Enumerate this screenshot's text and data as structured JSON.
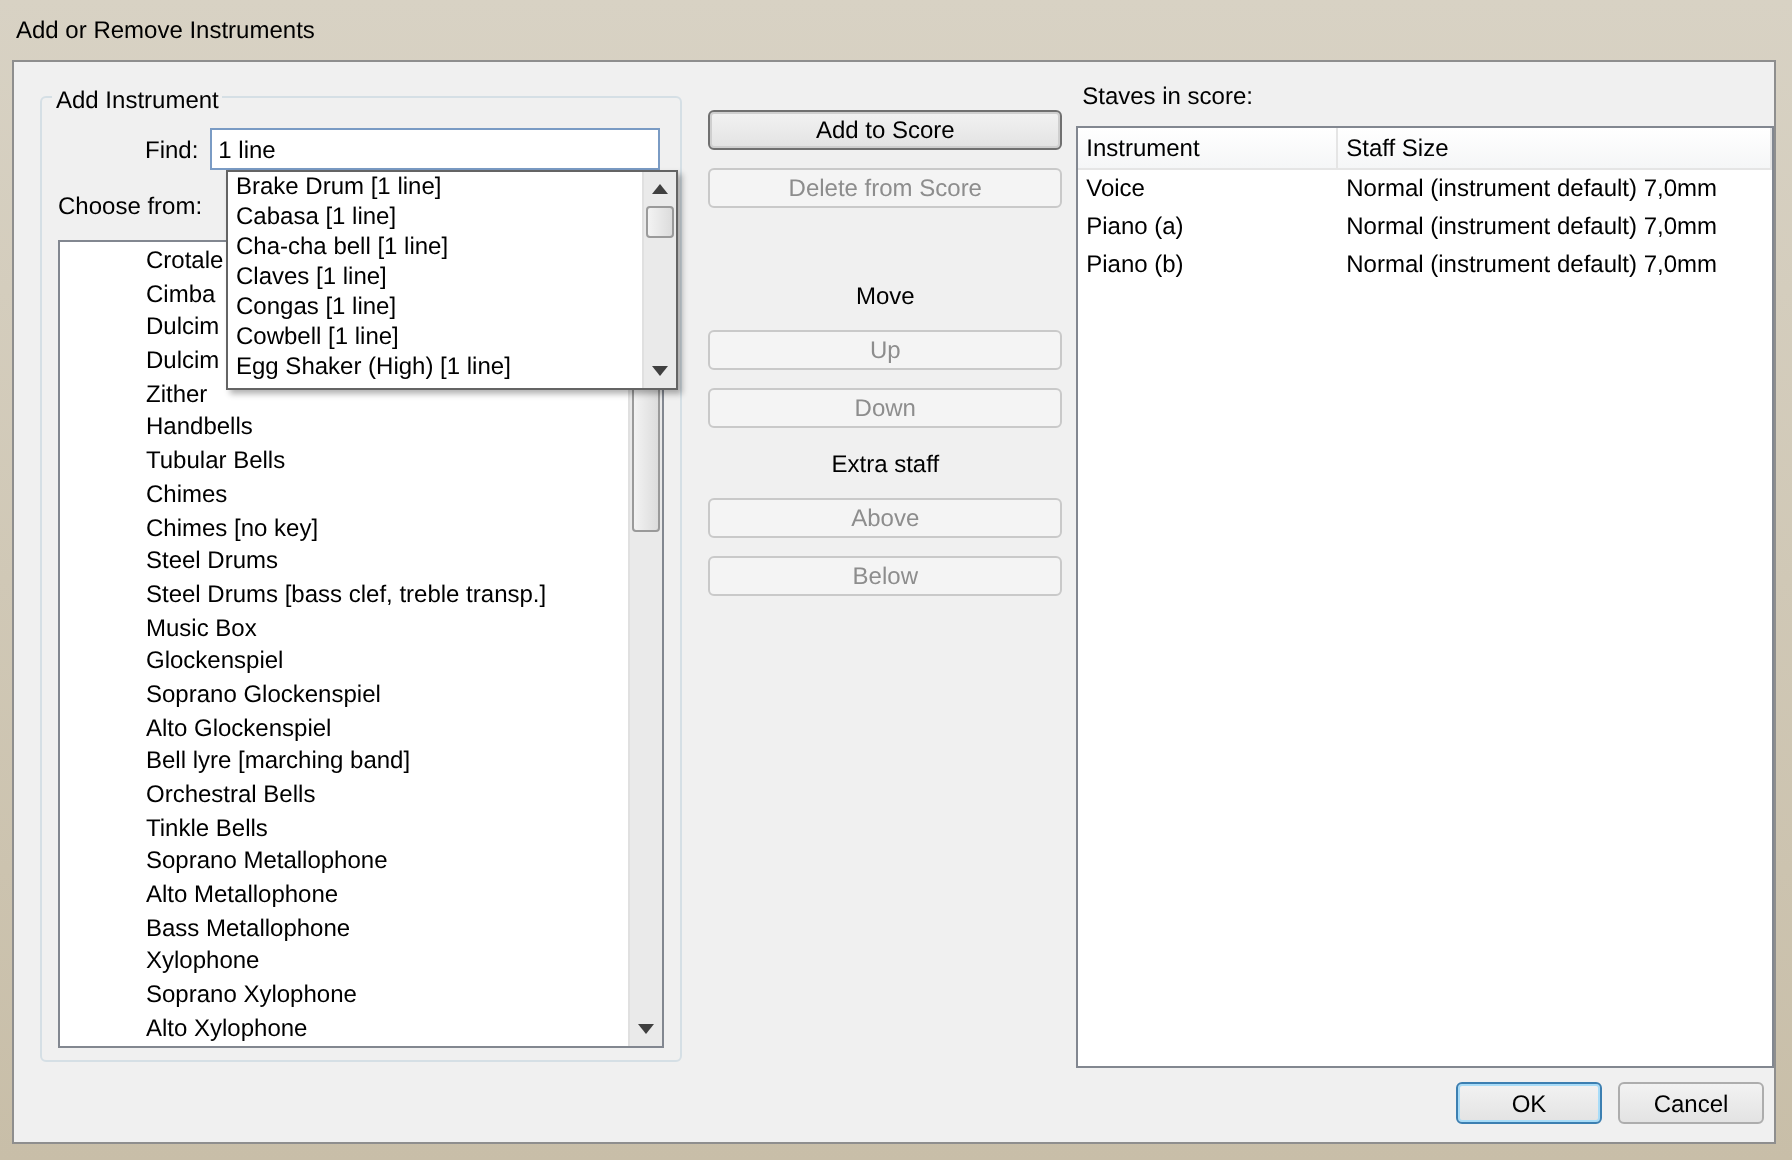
{
  "window": {
    "title": "Add or Remove Instruments"
  },
  "add_instrument": {
    "title": "Add Instrument",
    "find_label": "Find:",
    "find_value": "1 line",
    "choose_label": "Choose from:",
    "instruments": [
      "Crotale",
      "Cimba",
      "Dulcim",
      "Dulcim",
      "Zither",
      "Handbells",
      "Tubular Bells",
      "Chimes",
      "Chimes [no key]",
      "Steel Drums",
      "Steel Drums [bass clef, treble transp.]",
      "Music Box",
      "Glockenspiel",
      "Soprano Glockenspiel",
      "Alto Glockenspiel",
      "Bell lyre [marching band]",
      "Orchestral Bells",
      "Tinkle Bells",
      "Soprano Metallophone",
      "Alto Metallophone",
      "Bass Metallophone",
      "Xylophone",
      "Soprano Xylophone",
      "Alto Xylophone"
    ],
    "suggestions": [
      "Brake Drum [1 line]",
      "Cabasa [1 line]",
      "Cha-cha bell [1 line]",
      "Claves [1 line]",
      "Congas [1 line]",
      "Cowbell [1 line]",
      "Egg Shaker (High) [1 line]"
    ]
  },
  "actions": [
    {
      "kind": "button",
      "label": "Add to Score",
      "disabled": false,
      "default": true
    },
    {
      "kind": "button",
      "label": "Delete from Score",
      "disabled": true,
      "default": false
    },
    {
      "kind": "heading",
      "label": "Move"
    },
    {
      "kind": "button",
      "label": "Up",
      "disabled": true,
      "default": false
    },
    {
      "kind": "button",
      "label": "Down",
      "disabled": true,
      "default": false
    },
    {
      "kind": "heading",
      "label": "Extra staff"
    },
    {
      "kind": "button",
      "label": "Above",
      "disabled": true,
      "default": false
    },
    {
      "kind": "button",
      "label": "Below",
      "disabled": true,
      "default": false
    }
  ],
  "staves": {
    "title": "Staves in score:",
    "columns": [
      "Instrument",
      "Staff Size"
    ],
    "rows": [
      [
        "Voice",
        "Normal (instrument default) 7,0mm"
      ],
      [
        "Piano (a)",
        "Normal (instrument default) 7,0mm"
      ],
      [
        "Piano (b)",
        "Normal (instrument default) 7,0mm"
      ]
    ]
  },
  "buttons": [
    {
      "label": "OK",
      "default": true
    },
    {
      "label": "Cancel",
      "default": false
    }
  ]
}
